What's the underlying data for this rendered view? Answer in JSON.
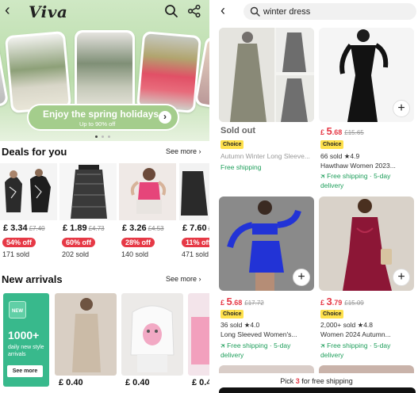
{
  "left": {
    "logo": "Viva",
    "promo": {
      "title": "Enjoy the spring holidays",
      "subtitle": "Up to 90% off",
      "arrow": "›"
    },
    "deals": {
      "title": "Deals for you",
      "see_more": "See more ›",
      "items": [
        {
          "price": "£ 3.34",
          "old_price": "£7.40",
          "discount": "54% off",
          "sold": "171 sold"
        },
        {
          "price": "£ 1.89",
          "old_price": "£4.73",
          "discount": "60% off",
          "sold": "202 sold"
        },
        {
          "price": "£ 3.26",
          "old_price": "£4.53",
          "discount": "28% off",
          "sold": "140 sold"
        },
        {
          "price": "£ 7.60",
          "old_price": "£",
          "discount": "11% off",
          "sold": "471 sold"
        }
      ]
    },
    "new_arrivals": {
      "title": "New arrivals",
      "see_more": "See more ›",
      "promo": {
        "badge": "NEW",
        "count": "1000+",
        "text": "daily new style arrivals",
        "button": "See more"
      },
      "items": [
        {
          "price": "£ 0.40"
        },
        {
          "price": "£ 0.40"
        },
        {
          "price": "£ 0.4"
        }
      ]
    }
  },
  "right": {
    "search": {
      "value": "winter dress"
    },
    "products": [
      {
        "status": "Sold out",
        "badge": "Choice",
        "name": "Autumn Winter Long Sleeve...",
        "shipping": "Free shipping"
      },
      {
        "currency": "£",
        "price_big": "5",
        "price_small": ".68",
        "old_price": "£15.65",
        "badge": "Choice",
        "sold": "66 sold",
        "rating": "★4.9",
        "name": "Hawthaw Women 2023...",
        "shipping": "Free shipping · 5-day delivery",
        "add": "+"
      },
      {
        "currency": "£",
        "price_big": "5",
        "price_small": ".68",
        "old_price": "£17.72",
        "badge": "Choice",
        "sold": "36 sold",
        "rating": "★4.0",
        "name": "Long Sleeved Women's...",
        "shipping": "Free shipping · 5-day delivery",
        "add": "+"
      },
      {
        "currency": "£",
        "price_big": "3",
        "price_small": ".79",
        "old_price": "£15.09",
        "badge": "Choice",
        "sold": "2,000+ sold",
        "rating": "★4.8",
        "name": "Women 2024 Autumn...",
        "shipping": "Free shipping · 5-day delivery",
        "add": "+"
      }
    ],
    "bottom": {
      "prefix": "Pick ",
      "count": "3",
      "suffix": " for free shipping"
    }
  },
  "colors": {
    "accent_red": "#e63946",
    "choice_yellow": "#ffe14c",
    "shipping_green": "#1d9e5a",
    "hero_green": "#b9dca9",
    "new_green": "#38b98c"
  }
}
